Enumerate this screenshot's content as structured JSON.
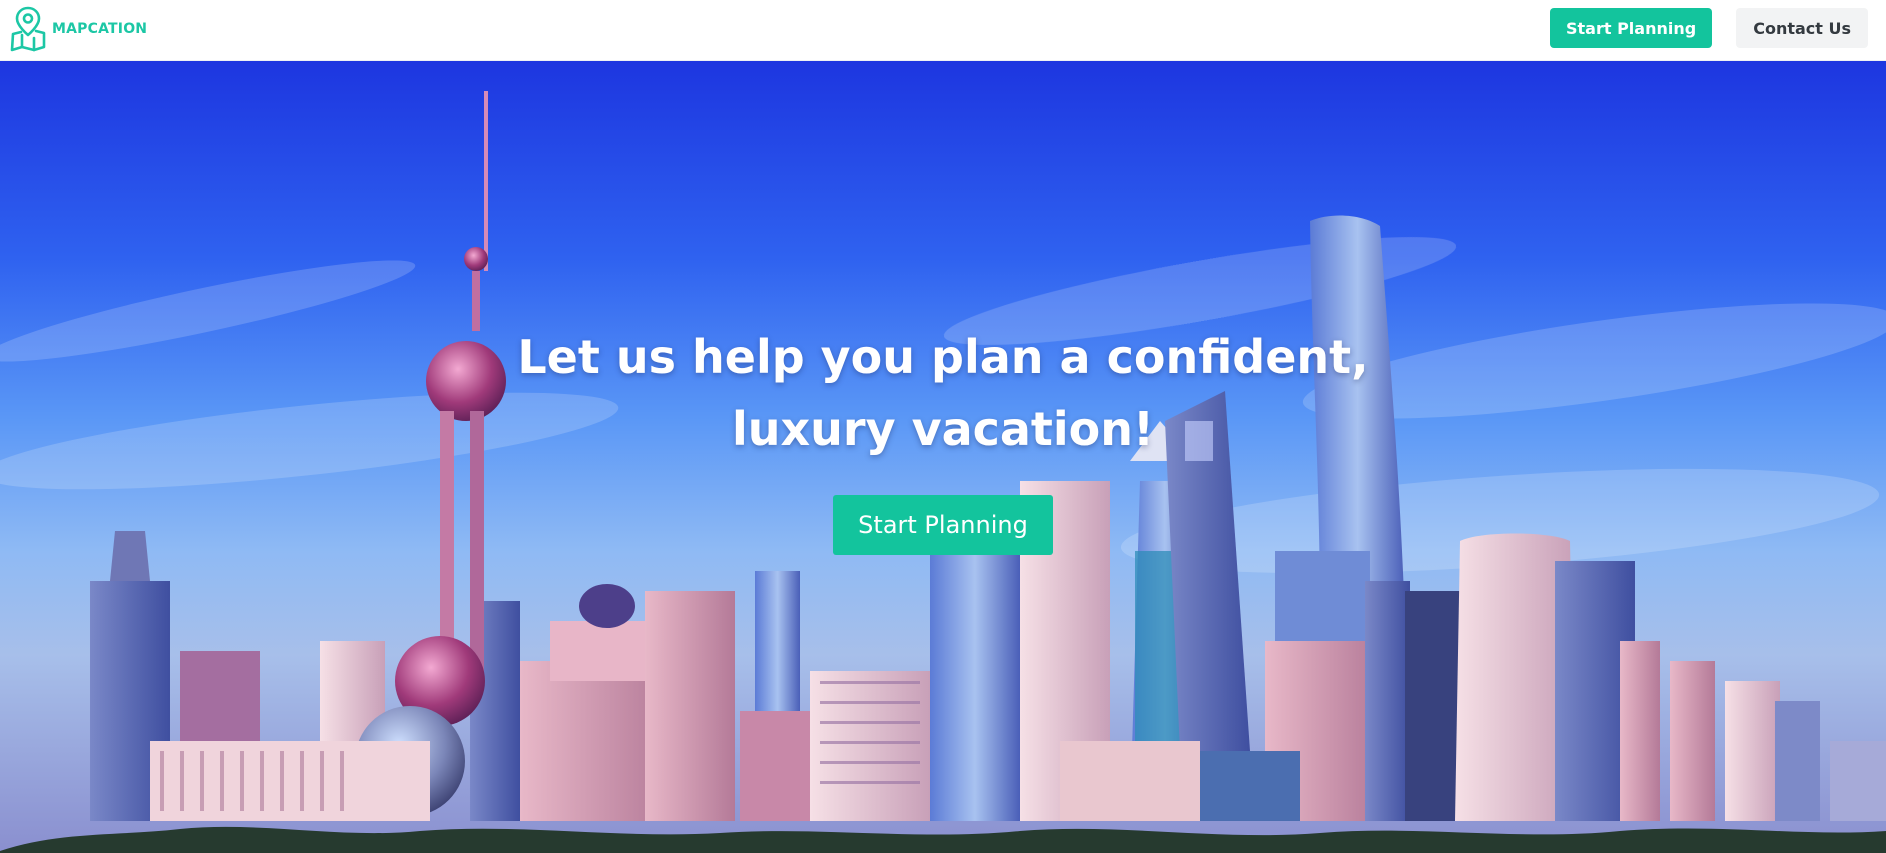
{
  "colors": {
    "brand": "#1cc7a5",
    "accent_button": "#13c49d",
    "secondary_button_bg": "#f2f3f4",
    "hero_text": "#ffffff"
  },
  "header": {
    "brand_name": "MAPCATION",
    "logo_icon": "map-pin-map-icon",
    "start_planning_label": "Start Planning",
    "contact_label": "Contact Us"
  },
  "hero": {
    "headline": "Let us help you plan a confident, luxury vacation!",
    "cta_label": "Start Planning",
    "background": "city-skyline-photo"
  }
}
